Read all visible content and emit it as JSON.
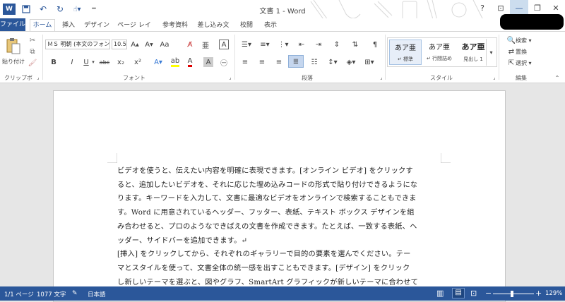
{
  "titlebar": {
    "title": "文書 1 - Word",
    "app_icon": "W",
    "help": "?",
    "restore_ribbon": "⊡",
    "minimize": "—",
    "maximize": "❐",
    "close": "✕"
  },
  "tabs": [
    "ファイル",
    "ホーム",
    "挿入",
    "デザイン",
    "ページ レイアウト",
    "参考資料",
    "差し込み文書",
    "校閲",
    "表示"
  ],
  "ribbon": {
    "clipboard": {
      "paste": "貼り付け",
      "label": "クリップボード"
    },
    "font": {
      "name": "ＭＳ 明朝 (本文のフォント",
      "size": "10.5",
      "bold": "B",
      "italic": "I",
      "underline": "U",
      "strike": "abc",
      "subscript": "x₂",
      "superscript": "x²",
      "font_color_letter": "A",
      "label": "フォント"
    },
    "paragraph": {
      "label": "段落"
    },
    "styles": {
      "items": [
        {
          "sample": "あア亜",
          "name": "↵ 標準"
        },
        {
          "sample": "あア亜",
          "name": "↵ 行間詰め"
        },
        {
          "sample": "あア亜",
          "name": "見出し 1"
        }
      ],
      "label": "スタイル"
    },
    "editing": {
      "find": "検索",
      "replace": "置換",
      "select": "選択",
      "label": "編集"
    }
  },
  "document": {
    "lines": [
      "ビデオを使うと、伝えたい内容を明確に表現できます。[オンライン ビデオ] をクリックす",
      "ると、追加したいビデオを、それに応じた埋め込みコードの形式で貼り付けできるようにな",
      "ります。キーワードを入力して、文書に最適なビデオをオンラインで検索することもできま",
      "す。Word に用意されているヘッダー、フッター、表紙、テキスト ボックス デザインを組",
      "み合わせると、プロのようなできばえの文書を作成できます。たとえば、一致する表紙、ヘ",
      "ッダー、サイドバーを追加できます。↵",
      "[挿入] をクリックしてから、それぞれのギャラリーで目的の要素を選んでください。テー",
      "マとスタイルを使って、文書全体の統一感を出すこともできます。[デザイン] をクリック",
      "し新しいテーマを選ぶと、図やグラフ、SmartArt グラフィックが新しいテーマに合わせて"
    ]
  },
  "status": {
    "page": "1/1 ページ",
    "words": "1077 文字",
    "language": "日本語",
    "zoom": "129%"
  },
  "colors": {
    "accent": "#2b579a",
    "highlight": "#ffff00",
    "font_color": "#e00000"
  }
}
